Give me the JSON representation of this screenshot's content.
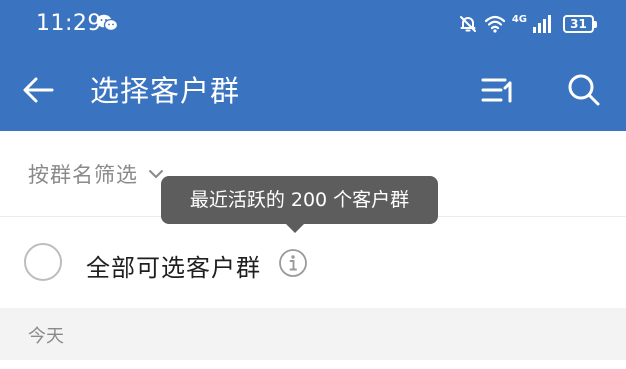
{
  "status_bar": {
    "time": "11:29",
    "network_type": "4G",
    "battery": "31",
    "icons": [
      "wechat-icon",
      "mute-bell-icon",
      "wifi-icon",
      "signal-icon",
      "battery-icon"
    ]
  },
  "app_bar": {
    "title": "选择客户群",
    "back_icon": "arrow-left-icon",
    "sort_icon": "sort-icon",
    "search_icon": "search-icon"
  },
  "filter": {
    "label": "按群名筛选",
    "icon": "chevron-down-icon"
  },
  "select_all": {
    "label": "全部可选客户群",
    "info_icon": "info-icon"
  },
  "tooltip": {
    "text": "最近活跃的 200 个客户群"
  },
  "section": {
    "label": "今天"
  },
  "colors": {
    "header": "#3a74c1",
    "tooltip_bg": "#5d5d5d",
    "section_bg": "#f3f3f3",
    "muted_text": "#8a8a8a"
  }
}
